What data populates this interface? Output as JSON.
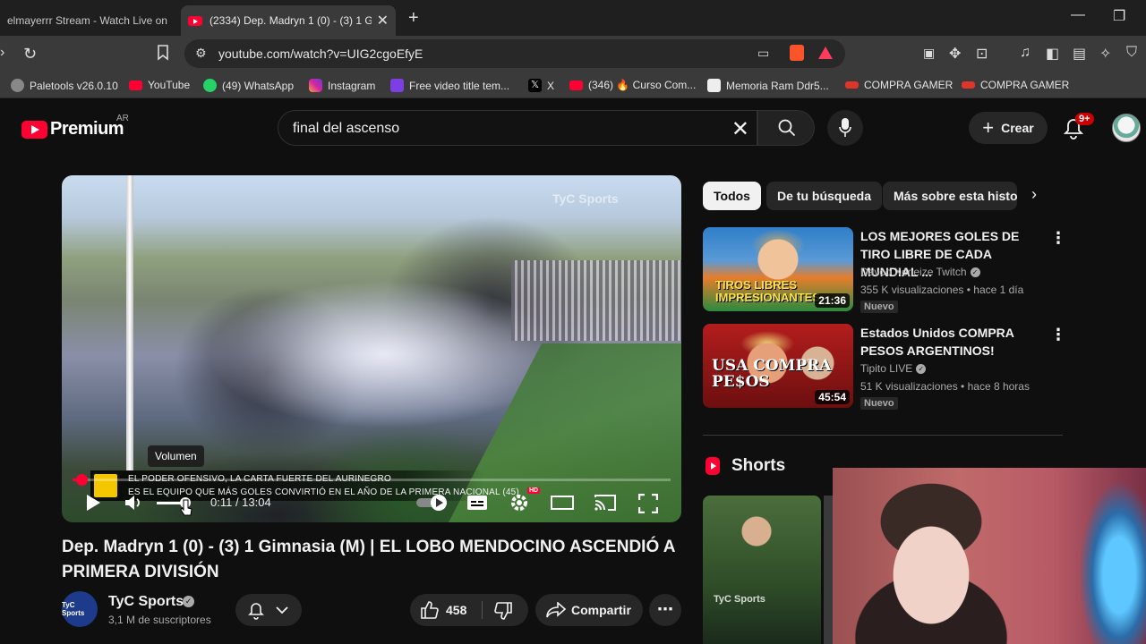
{
  "browser": {
    "tabs": [
      {
        "title": "elmayerrr Stream - Watch Live on",
        "active": false
      },
      {
        "title": "(2334) Dep. Madryn 1 (0) - (3) 1 G",
        "active": true
      }
    ],
    "url": "youtube.com/watch?v=UIG2cgoEfyE",
    "bookmarks": [
      {
        "label": "Paletools v26.0.10",
        "icon_color": "#888888"
      },
      {
        "label": "YouTube",
        "icon_color": "#ff0033"
      },
      {
        "label": "(49) WhatsApp",
        "icon_color": "#25d366"
      },
      {
        "label": "Instagram",
        "icon_color": "#d6249f"
      },
      {
        "label": "Free video title tem...",
        "icon_color": "#7b3fe4"
      },
      {
        "label": "X",
        "icon_color": "#000000"
      },
      {
        "label": "(346) 🔥 Curso Com...",
        "icon_color": "#ff0033"
      },
      {
        "label": "Memoria Ram Ddr5...",
        "icon_color": "#eeeeee"
      },
      {
        "label": "COMPRA GAMER",
        "icon_color": "#e0352b"
      },
      {
        "label": "COMPRA GAMER",
        "icon_color": "#e0352b"
      }
    ]
  },
  "header": {
    "logo_text": "Premium",
    "country": "AR",
    "search_value": "final del ascenso",
    "create_label": "Crear",
    "notifications_badge": "9+"
  },
  "player": {
    "watermark": "TyC Sports",
    "volume_tooltip": "Volumen",
    "chyron_line1": "EL PODER OFENSIVO, LA CARTA FUERTE DEL AURINEGRO",
    "chyron_line2": "ES EL EQUIPO QUE MÁS GOLES CONVIRTIÓ EN EL AÑO DE LA PRIMERA NACIONAL (45)",
    "time": "0:11 / 13:04",
    "progress": 0.014,
    "hd_badge": "HD"
  },
  "video": {
    "title": "Dep. Madryn 1 (0) - (3) 1 Gimnasia (M) | EL LOBO MENDOCINO ASCENDIÓ A PRIMERA DIVISIÓN",
    "channel": "TyC Sports",
    "channel_avatar_text": "TyC Sports",
    "subscribers": "3,1 M de suscriptores",
    "likes": "458",
    "share_label": "Compartir"
  },
  "sidebar": {
    "chips": [
      "Todos",
      "De tu búsqueda",
      "Más sobre esta histor"
    ],
    "recommendations": [
      {
        "title": "LOS MEJORES GOLES DE TIRO LIBRE DE CADA MUNDIAL ...",
        "channel": "Davoo Xeneize Twitch",
        "meta": "355 K visualizaciones • hace 1 día",
        "badge": "Nuevo",
        "duration": "21:36",
        "thumb_text": "TIROS LIBRES IMPRESIONANTES"
      },
      {
        "title": "Estados Unidos COMPRA PESOS ARGENTINOS!",
        "channel": "Tipito LIVE",
        "meta": "51 K visualizaciones • hace 8 horas",
        "badge": "Nuevo",
        "duration": "45:54",
        "thumb_text": "USA COMPRA PE$OS"
      }
    ],
    "shorts_title": "Shorts",
    "short_watermark": "TyC Sports"
  }
}
